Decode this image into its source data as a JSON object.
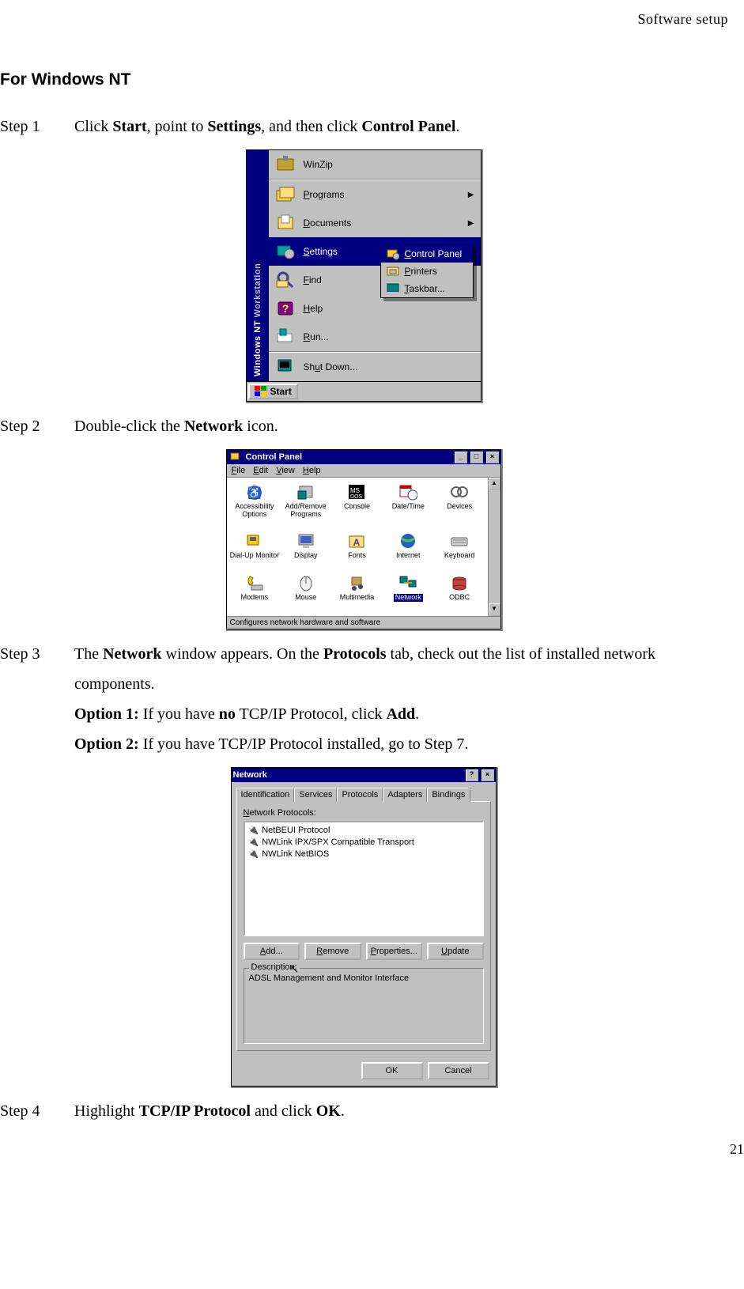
{
  "header": {
    "section": "Software  setup"
  },
  "page_number": "21",
  "title": "For Windows NT",
  "steps": {
    "s1": {
      "label": "Step 1",
      "pre": "Click ",
      "b1": "Start",
      "mid1": ", point to ",
      "b2": "Settings",
      "mid2": ", and then click ",
      "b3": "Control Panel",
      "post": "."
    },
    "s2": {
      "label": "Step 2",
      "pre": "Double-click the ",
      "b1": "Network",
      "post": " icon."
    },
    "s3": {
      "label": "Step 3",
      "pre": "The ",
      "b1": "Network",
      "mid1": " window appears. On the ",
      "b2": "Protocols",
      "mid2": " tab, check out the list of installed network components.",
      "opt1_label": "Option 1:",
      "opt1_pre": " If you have ",
      "opt1_b1": "no",
      "opt1_mid": " TCP/IP Protocol, click ",
      "opt1_b2": "Add",
      "opt1_post": ".",
      "opt2_label": "Option 2:",
      "opt2_text": " If you have TCP/IP Protocol installed, go to Step 7."
    },
    "s4": {
      "label": "Step 4",
      "pre": "Highlight ",
      "b1": "TCP/IP Protocol",
      "mid": " and click ",
      "b2": "OK",
      "post": "."
    }
  },
  "fig1": {
    "sidebar_a": "Windows NT",
    "sidebar_b": " Workstation",
    "items": {
      "winzip": "WinZip",
      "programs": "Programs",
      "documents": "Documents",
      "settings": "Settings",
      "find": "Find",
      "help": "Help",
      "run": "Run...",
      "shutdown": "Shut Down..."
    },
    "submenu": {
      "cp": "Control Panel",
      "printers": "Printers",
      "taskbar": "Taskbar..."
    },
    "start": "Start"
  },
  "fig2": {
    "title": "Control Panel",
    "menus": {
      "file": "File",
      "edit": "Edit",
      "view": "View",
      "help": "Help"
    },
    "items": {
      "access": "Accessibility Options",
      "addrem": "Add/Remove Programs",
      "console": "Console",
      "datetime": "Date/Time",
      "devices": "Devices",
      "dialup": "Dial-Up Monitor",
      "display": "Display",
      "fonts": "Fonts",
      "internet": "Internet",
      "keyboard": "Keyboard",
      "modems": "Modems",
      "mouse": "Mouse",
      "multimedia": "Multimedia",
      "network": "Network",
      "odbc": "ODBC"
    },
    "status": "Configures network hardware and software"
  },
  "fig3": {
    "title": "Network",
    "tabs": {
      "ident": "Identification",
      "services": "Services",
      "protocols": "Protocols",
      "adapters": "Adapters",
      "bindings": "Bindings"
    },
    "list_label": "Network Protocols:",
    "protocols": {
      "p1": "NetBEUI Protocol",
      "p2": "NWLink IPX/SPX Compatible Transport",
      "p3": "NWLink NetBIOS"
    },
    "buttons": {
      "add": "Add...",
      "remove": "Remove",
      "props": "Properties...",
      "update": "Update"
    },
    "desc_label": "Description:",
    "desc_text": "ADSL Management and Monitor Interface",
    "ok": "OK",
    "cancel": "Cancel"
  }
}
